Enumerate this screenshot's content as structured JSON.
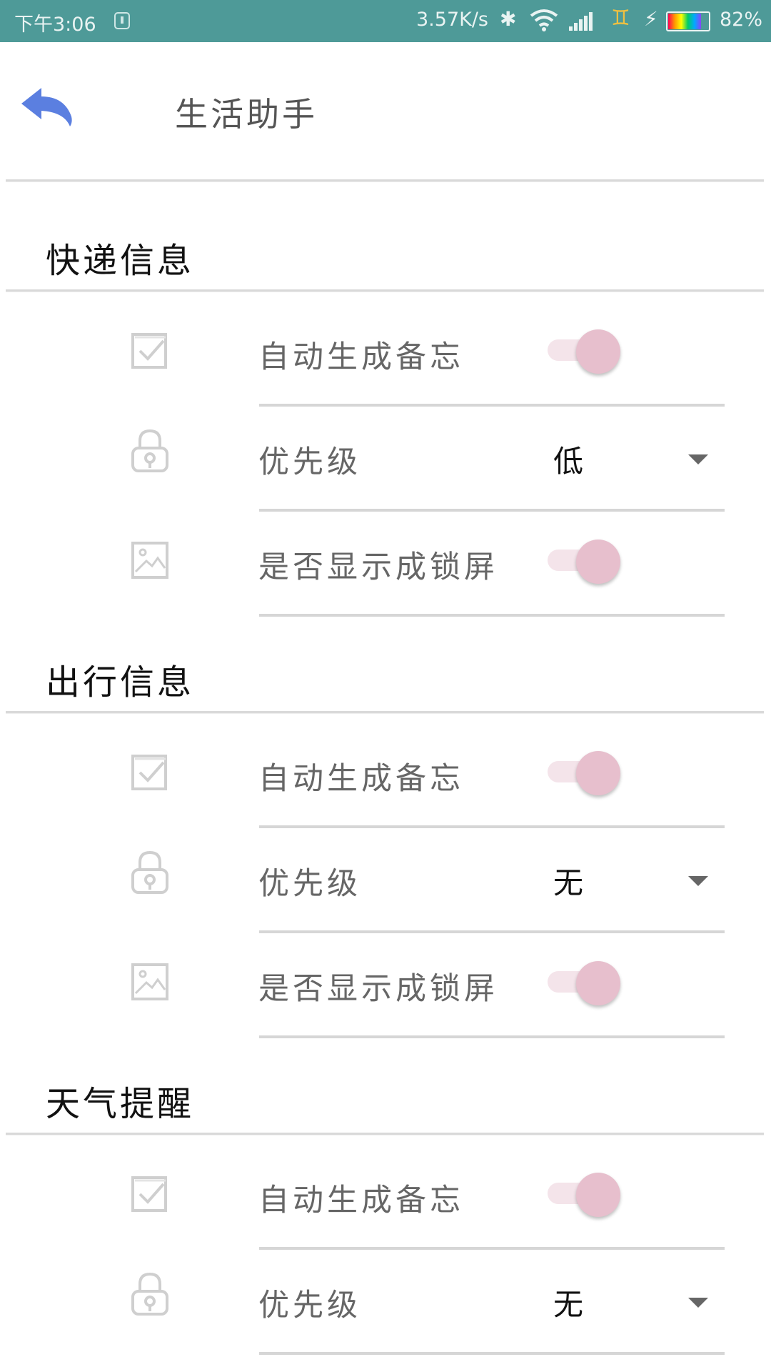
{
  "status_bar": {
    "time": "下午3:06",
    "net_speed": "3.57K/s",
    "bluetooth_glyph": "✱",
    "charging_glyph": "⚡",
    "gemini_glyph": "♊",
    "battery_pct": "82%",
    "battery_level": 0.82,
    "background_color": "#4e9a98"
  },
  "header": {
    "title": "生活助手",
    "back_icon": "back-arrow-icon",
    "accent_color": "#5b7fe0"
  },
  "sections": [
    {
      "title": "快递信息",
      "rows": [
        {
          "icon": "checkbox-icon",
          "label": "自动生成备忘",
          "control": "toggle",
          "on": true
        },
        {
          "icon": "lock-icon",
          "label": "优先级",
          "control": "select",
          "value": "低"
        },
        {
          "icon": "image-icon",
          "label": "是否显示成锁屏",
          "control": "toggle",
          "on": true
        }
      ]
    },
    {
      "title": "出行信息",
      "rows": [
        {
          "icon": "checkbox-icon",
          "label": "自动生成备忘",
          "control": "toggle",
          "on": true
        },
        {
          "icon": "lock-icon",
          "label": "优先级",
          "control": "select",
          "value": "无"
        },
        {
          "icon": "image-icon",
          "label": "是否显示成锁屏",
          "control": "toggle",
          "on": true
        }
      ]
    },
    {
      "title": "天气提醒",
      "rows": [
        {
          "icon": "checkbox-icon",
          "label": "自动生成备忘",
          "control": "toggle",
          "on": true
        },
        {
          "icon": "lock-icon",
          "label": "优先级",
          "control": "select",
          "value": "无"
        }
      ]
    }
  ],
  "toggle_color": "#e7bfcd"
}
